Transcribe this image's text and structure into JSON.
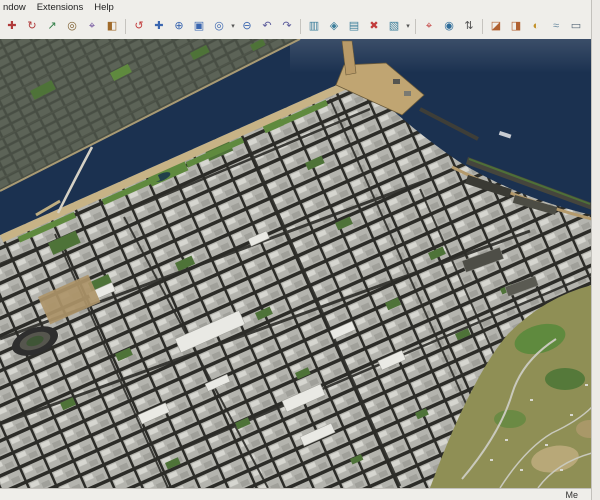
{
  "menu": {
    "items": [
      "ndow",
      "Extensions",
      "Help"
    ]
  },
  "toolbar": {
    "dropdown_glyph": "▾",
    "icons": [
      {
        "name": "move-tool",
        "glyph": "✚",
        "color": "#b03a3a"
      },
      {
        "name": "rotate-tool",
        "glyph": "↻",
        "color": "#b03a3a"
      },
      {
        "name": "scale-tool",
        "glyph": "↗",
        "color": "#2f7d46"
      },
      {
        "name": "offset-tool",
        "glyph": "◎",
        "color": "#7a5a2a"
      },
      {
        "name": "tape-measure-tool",
        "glyph": "⌖",
        "color": "#6a4a9a"
      },
      {
        "name": "paint-bucket-tool",
        "glyph": "◧",
        "color": "#a06a2a"
      },
      {
        "name": "orbit-tool",
        "glyph": "↺",
        "color": "#c23b3b"
      },
      {
        "name": "pan-tool",
        "glyph": "✚",
        "color": "#3a66b0"
      },
      {
        "name": "zoom-tool",
        "glyph": "⊕",
        "color": "#3a66b0"
      },
      {
        "name": "zoom-window-tool",
        "glyph": "▣",
        "color": "#3a66b0"
      },
      {
        "name": "zoom-extents-tool",
        "glyph": "◎",
        "color": "#3a66b0"
      },
      {
        "name": "zoom-out-tool",
        "glyph": "⊖",
        "color": "#3a66b0"
      },
      {
        "name": "previous-view",
        "glyph": "↶",
        "color": "#5a5a9a"
      },
      {
        "name": "next-view",
        "glyph": "↷",
        "color": "#5a5a9a"
      },
      {
        "name": "front-view",
        "glyph": "▥",
        "color": "#3a7d9a"
      },
      {
        "name": "iso-view",
        "glyph": "◈",
        "color": "#3a7d9a"
      },
      {
        "name": "top-view",
        "glyph": "▤",
        "color": "#3a7d9a"
      },
      {
        "name": "delete-guides",
        "glyph": "✖",
        "color": "#c23b3b"
      },
      {
        "name": "back-view",
        "glyph": "▧",
        "color": "#3a7d9a"
      },
      {
        "name": "position-camera-tool",
        "glyph": "⌖",
        "color": "#c23b3b"
      },
      {
        "name": "look-around-tool",
        "glyph": "◉",
        "color": "#2f6d9a"
      },
      {
        "name": "walk-tool",
        "glyph": "⇅",
        "color": "#555555"
      },
      {
        "name": "section-plane-tool",
        "glyph": "◪",
        "color": "#b06030"
      },
      {
        "name": "section-cuts-toggle",
        "glyph": "◨",
        "color": "#b06030"
      },
      {
        "name": "shadows-toggle",
        "glyph": "◐",
        "color": "#c2912a"
      },
      {
        "name": "fog-toggle",
        "glyph": "≈",
        "color": "#6a8aa0"
      },
      {
        "name": "x-ray-toggle",
        "glyph": "▭",
        "color": "#556677"
      }
    ]
  },
  "statusbar": {
    "measurements_label": "Me"
  },
  "viewport": {
    "description": "3D aerial city model on a bay: dense gray blocks, dark streets, green parks, sandy coastline, navy water, harbor piers, olive hillside suburbs",
    "colors": {
      "water": "#1b3150",
      "street": "#2c2c28",
      "block": "#b4b4ae",
      "block_light": "#d6d6d0",
      "block_mid": "#a0a09a",
      "park": "#4e7338",
      "park_bright": "#5f8a3e",
      "beach": "#c7b386",
      "pier": "#c0a572",
      "hill": "#8f8f55",
      "hill_road": "#c9c9bd",
      "building_white": "#e9e9e4",
      "pond": "#22404a",
      "tan_field": "#ad9468"
    }
  }
}
